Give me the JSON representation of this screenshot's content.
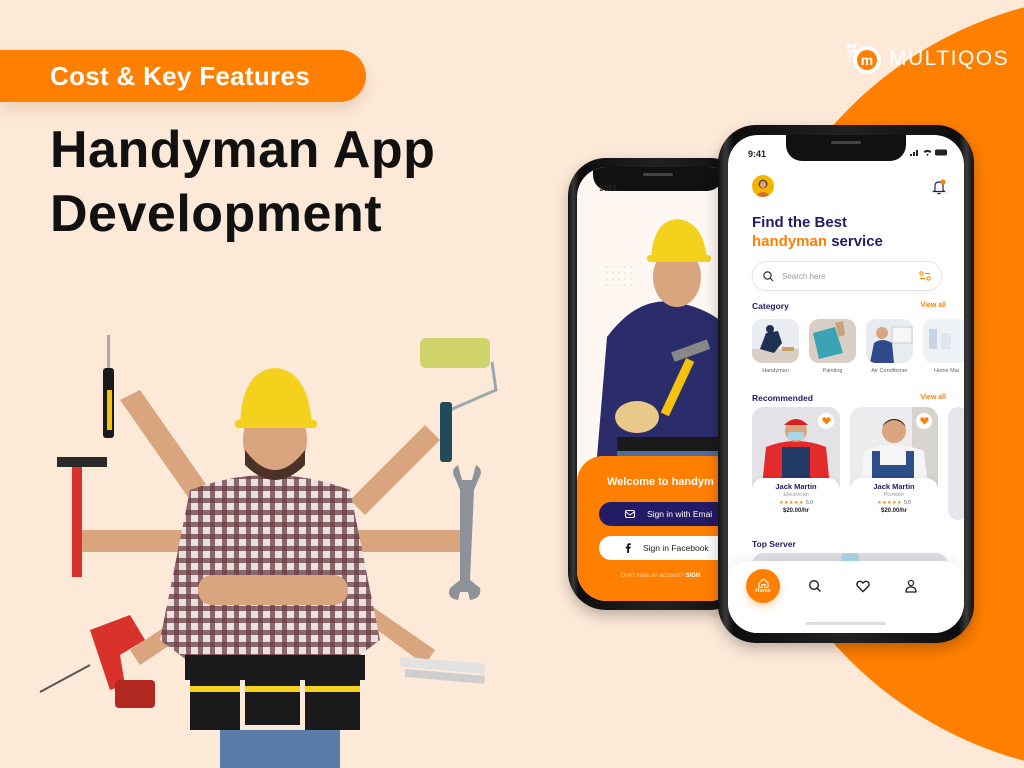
{
  "colors": {
    "background": "#fde9d8",
    "accent": "#ff7f00",
    "navy": "#231b63",
    "headline": "#111111"
  },
  "banner": {
    "badge_label": "Cost & Key Features",
    "headline_line1": "Handyman App",
    "headline_line2": "Development"
  },
  "brand": {
    "logo_text": "MULTIQOS",
    "logo_icon": "multiqos-logo-icon"
  },
  "illustration": {
    "subject": "handyman-with-six-arms-holding-tools",
    "tools": [
      "screwdriver",
      "hammer",
      "drill",
      "paint-roller",
      "wrench",
      "folding-ruler",
      "tool-belt"
    ]
  },
  "phone_left": {
    "status_time": "9:41",
    "welcome_title": "Welcome to handym",
    "signin_email_label": "Sign in with Emai",
    "signin_facebook_label": "Sign in Facebook",
    "account_prompt": "Don't have an account?",
    "account_link": "SIGN"
  },
  "phone_right": {
    "status_time": "9:41",
    "hero_line1": "Find the Best",
    "hero_accent": "handyman",
    "hero_rest": "service",
    "search_placeholder": "Search here",
    "category_title": "Category",
    "category_view_all": "View all",
    "categories": [
      {
        "label": "Handyman"
      },
      {
        "label": "Painting"
      },
      {
        "label": "Air Conditioner"
      },
      {
        "label": "Home Mai"
      }
    ],
    "recommended_title": "Recommended",
    "recommended_view_all": "View all",
    "recommended": [
      {
        "name": "Jack Martin",
        "role": "Electrician",
        "rating": "5.0",
        "stars": "★★★★★",
        "price": "$20.00/hr",
        "favorite": true
      },
      {
        "name": "Jack Martin",
        "role": "Plumber",
        "rating": "5.0",
        "stars": "★★★★★",
        "price": "$20.00/hr",
        "favorite": true
      }
    ],
    "top_server_title": "Top Server",
    "nav": {
      "home_label": "Home",
      "items": [
        "home",
        "search",
        "favorites",
        "profile"
      ]
    }
  }
}
